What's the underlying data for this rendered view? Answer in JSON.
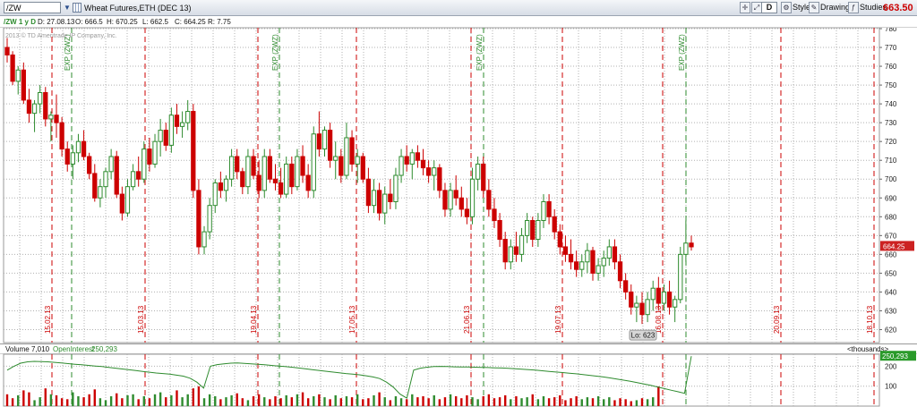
{
  "toolbar": {
    "symbol": "/ZW",
    "description": "Wheat Futures,ETH (DEC 13)",
    "aggregation": "D",
    "style_label": "Style",
    "drawings_label": "Drawings",
    "studies_label": "Studies",
    "last_price": "663.50"
  },
  "infobar": {
    "title": "/ZW 1 y D",
    "date": "D: 27.08.13",
    "open": "O: 666.5",
    "high": "H: 670.25",
    "low": "L: 662.5",
    "close": "C: 664.25",
    "range": "R: 7.75"
  },
  "copyright": "2013 © TD Ameritrade IP Company, Inc.",
  "colors": {
    "up": "#2e8b2e",
    "down": "#cc0000",
    "grid": "#b0b0b0",
    "price_tag": "#cc2222",
    "oi_tag": "#2a9a2a"
  },
  "price_axis": {
    "min": 615,
    "max": 780,
    "ticks": [
      "780",
      "770",
      "760",
      "750",
      "740",
      "730",
      "720",
      "710",
      "700",
      "690",
      "680",
      "670",
      "660",
      "650",
      "640",
      "630",
      "620"
    ]
  },
  "price_tag": "664.25",
  "low_label": "Lo: 623",
  "expiration_label": "EXP (ZWZ)",
  "dates": [
    "15.02.13",
    "15.03.13",
    "19.04.13",
    "17.05.13",
    "21.06.13",
    "19.07.13",
    "16.08.13",
    "20.09.13",
    "18.10.13"
  ],
  "volume": {
    "label": "Volume",
    "value": "7,010",
    "oi_label": "OpenInterest",
    "oi_value": "250,293",
    "units": "<thousands>",
    "ticks": [
      "200",
      "100"
    ],
    "oi_tag": "250,293"
  },
  "chart_data": {
    "type": "candlestick",
    "ohlc": [
      [
        770,
        775,
        762,
        766
      ],
      [
        766,
        768,
        750,
        752
      ],
      [
        752,
        760,
        745,
        758
      ],
      [
        758,
        762,
        740,
        742
      ],
      [
        742,
        748,
        730,
        735
      ],
      [
        735,
        742,
        725,
        740
      ],
      [
        740,
        750,
        735,
        746
      ],
      [
        746,
        749,
        728,
        732
      ],
      [
        732,
        736,
        720,
        734
      ],
      [
        734,
        745,
        722,
        730
      ],
      [
        730,
        733,
        712,
        716
      ],
      [
        716,
        720,
        704,
        708
      ],
      [
        708,
        718,
        700,
        714
      ],
      [
        714,
        724,
        709,
        720
      ],
      [
        720,
        726,
        710,
        712
      ],
      [
        712,
        714,
        700,
        703
      ],
      [
        703,
        708,
        688,
        690
      ],
      [
        690,
        700,
        685,
        696
      ],
      [
        696,
        706,
        690,
        704
      ],
      [
        704,
        716,
        700,
        712
      ],
      [
        712,
        715,
        690,
        692
      ],
      [
        692,
        696,
        678,
        682
      ],
      [
        682,
        700,
        680,
        696
      ],
      [
        696,
        708,
        694,
        704
      ],
      [
        704,
        712,
        696,
        700
      ],
      [
        700,
        720,
        698,
        716
      ],
      [
        716,
        722,
        704,
        708
      ],
      [
        708,
        724,
        706,
        720
      ],
      [
        720,
        732,
        712,
        726
      ],
      [
        726,
        730,
        715,
        718
      ],
      [
        718,
        738,
        714,
        734
      ],
      [
        734,
        740,
        724,
        728
      ],
      [
        728,
        736,
        722,
        730
      ],
      [
        730,
        742,
        726,
        736
      ],
      [
        736,
        740,
        690,
        694
      ],
      [
        694,
        700,
        660,
        664
      ],
      [
        664,
        675,
        660,
        672
      ],
      [
        672,
        690,
        668,
        686
      ],
      [
        686,
        700,
        682,
        698
      ],
      [
        698,
        704,
        690,
        694
      ],
      [
        694,
        702,
        688,
        700
      ],
      [
        700,
        716,
        696,
        712
      ],
      [
        712,
        716,
        700,
        704
      ],
      [
        704,
        706,
        692,
        696
      ],
      [
        696,
        716,
        692,
        712
      ],
      [
        712,
        716,
        700,
        702
      ],
      [
        702,
        710,
        690,
        694
      ],
      [
        694,
        716,
        690,
        712
      ],
      [
        712,
        716,
        698,
        700
      ],
      [
        700,
        708,
        694,
        698
      ],
      [
        698,
        706,
        690,
        692
      ],
      [
        692,
        712,
        690,
        708
      ],
      [
        708,
        712,
        692,
        696
      ],
      [
        696,
        716,
        694,
        712
      ],
      [
        712,
        718,
        698,
        702
      ],
      [
        702,
        708,
        690,
        694
      ],
      [
        694,
        728,
        690,
        724
      ],
      [
        724,
        736,
        712,
        716
      ],
      [
        716,
        728,
        712,
        726
      ],
      [
        726,
        730,
        706,
        710
      ],
      [
        710,
        720,
        700,
        712
      ],
      [
        712,
        716,
        698,
        702
      ],
      [
        702,
        730,
        700,
        722
      ],
      [
        722,
        726,
        704,
        708
      ],
      [
        708,
        716,
        698,
        712
      ],
      [
        712,
        714,
        698,
        700
      ],
      [
        700,
        706,
        682,
        686
      ],
      [
        686,
        700,
        682,
        694
      ],
      [
        694,
        698,
        678,
        682
      ],
      [
        682,
        696,
        676,
        692
      ],
      [
        692,
        700,
        684,
        688
      ],
      [
        688,
        706,
        684,
        702
      ],
      [
        702,
        716,
        698,
        712
      ],
      [
        712,
        718,
        704,
        708
      ],
      [
        708,
        716,
        700,
        714
      ],
      [
        714,
        718,
        706,
        710
      ],
      [
        710,
        716,
        702,
        706
      ],
      [
        706,
        710,
        698,
        702
      ],
      [
        702,
        710,
        694,
        706
      ],
      [
        706,
        708,
        690,
        694
      ],
      [
        694,
        698,
        680,
        684
      ],
      [
        684,
        698,
        680,
        694
      ],
      [
        694,
        702,
        686,
        690
      ],
      [
        690,
        696,
        680,
        684
      ],
      [
        684,
        690,
        676,
        680
      ],
      [
        680,
        706,
        676,
        700
      ],
      [
        700,
        712,
        694,
        708
      ],
      [
        708,
        712,
        690,
        694
      ],
      [
        694,
        700,
        680,
        684
      ],
      [
        684,
        690,
        674,
        678
      ],
      [
        678,
        682,
        664,
        668
      ],
      [
        668,
        672,
        652,
        656
      ],
      [
        656,
        668,
        652,
        664
      ],
      [
        664,
        672,
        656,
        660
      ],
      [
        660,
        674,
        656,
        670
      ],
      [
        670,
        682,
        666,
        678
      ],
      [
        678,
        680,
        664,
        668
      ],
      [
        668,
        682,
        664,
        678
      ],
      [
        678,
        692,
        674,
        688
      ],
      [
        688,
        692,
        676,
        680
      ],
      [
        680,
        684,
        668,
        672
      ],
      [
        672,
        676,
        660,
        664
      ],
      [
        664,
        670,
        656,
        660
      ],
      [
        660,
        668,
        652,
        656
      ],
      [
        656,
        662,
        648,
        652
      ],
      [
        652,
        660,
        648,
        656
      ],
      [
        656,
        666,
        650,
        662
      ],
      [
        662,
        664,
        646,
        650
      ],
      [
        650,
        658,
        646,
        654
      ],
      [
        654,
        662,
        648,
        658
      ],
      [
        658,
        668,
        654,
        664
      ],
      [
        664,
        668,
        652,
        656
      ],
      [
        656,
        660,
        642,
        646
      ],
      [
        646,
        650,
        636,
        640
      ],
      [
        640,
        644,
        628,
        632
      ],
      [
        632,
        638,
        624,
        634
      ],
      [
        634,
        640,
        623,
        628
      ],
      [
        628,
        640,
        624,
        636
      ],
      [
        636,
        646,
        630,
        642
      ],
      [
        642,
        648,
        630,
        634
      ],
      [
        634,
        644,
        630,
        640
      ],
      [
        640,
        646,
        628,
        632
      ],
      [
        632,
        638,
        624,
        636
      ],
      [
        636,
        664,
        634,
        660
      ],
      [
        660,
        678,
        656,
        666
      ],
      [
        666,
        670,
        662,
        664
      ]
    ],
    "volume": [
      60,
      40,
      55,
      80,
      70,
      30,
      45,
      90,
      60,
      55,
      40,
      35,
      70,
      50,
      45,
      60,
      85,
      40,
      30,
      50,
      65,
      40,
      55,
      60,
      35,
      50,
      40,
      60,
      70,
      45,
      55,
      80,
      45,
      60,
      90,
      100,
      40,
      60,
      50,
      35,
      45,
      55,
      65,
      40,
      30,
      50,
      60,
      45,
      35,
      50,
      40,
      55,
      45,
      60,
      70,
      40,
      50,
      60,
      45,
      35,
      55,
      40,
      50,
      45,
      60,
      35,
      40,
      55,
      70,
      45,
      30,
      50,
      40,
      35,
      60,
      45,
      50,
      40,
      55,
      35,
      45,
      60,
      50,
      40,
      55,
      45,
      35,
      50,
      60,
      40,
      45,
      55,
      35,
      50,
      40,
      45,
      60,
      35,
      50,
      40,
      45,
      55,
      30,
      40,
      50,
      35,
      45,
      40,
      50,
      35,
      45,
      30,
      40,
      35,
      25,
      30,
      40,
      35,
      45,
      100
    ],
    "open_interest": [
      180,
      200,
      215,
      222,
      224,
      223,
      222,
      219,
      216,
      213,
      210,
      207,
      204,
      201,
      198,
      194,
      190,
      186,
      182,
      178,
      174,
      170,
      166,
      163,
      160,
      155,
      150,
      140,
      120,
      90,
      200,
      208,
      212,
      215,
      216,
      214,
      212,
      210,
      207,
      204,
      201,
      198,
      195,
      191,
      187,
      183,
      179,
      175,
      171,
      167,
      163,
      160,
      157,
      152,
      146,
      138,
      120,
      95,
      60,
      40,
      180,
      190,
      195,
      198,
      199,
      198,
      197,
      196,
      196,
      195,
      194,
      193,
      192,
      191,
      189,
      187,
      185,
      183,
      180,
      177,
      174,
      171,
      168,
      165,
      162,
      158,
      154,
      150,
      146,
      141,
      136,
      130,
      124,
      118,
      111,
      104,
      96,
      88,
      80,
      72,
      64,
      250
    ],
    "price_axis_range": [
      615,
      780
    ],
    "volume_axis_ticks": [
      "200",
      "100"
    ]
  }
}
